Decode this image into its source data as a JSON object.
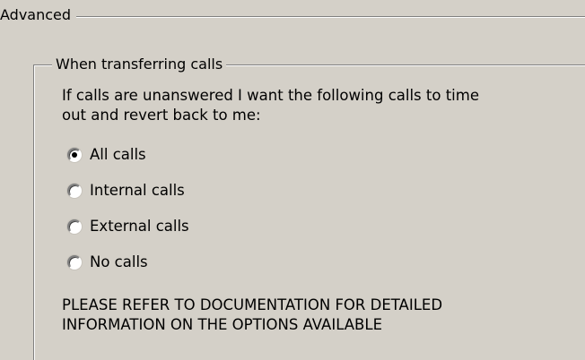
{
  "advanced_group": {
    "title": "Advanced"
  },
  "transfer_group": {
    "title": "When transferring calls",
    "description_line1": "If calls are unanswered I want the following calls to time",
    "description_line2": "out and revert back to me:",
    "options": [
      {
        "label": "All calls",
        "selected": true
      },
      {
        "label": "Internal calls",
        "selected": false
      },
      {
        "label": "External calls",
        "selected": false
      },
      {
        "label": "No calls",
        "selected": false
      }
    ],
    "note_line1": "PLEASE REFER TO DOCUMENTATION FOR DETAILED",
    "note_line2": "INFORMATION ON THE OPTIONS AVAILABLE"
  }
}
